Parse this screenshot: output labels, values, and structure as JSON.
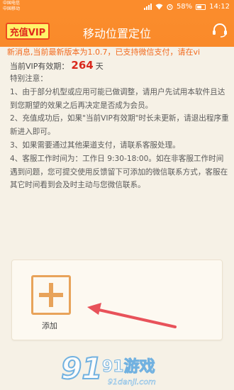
{
  "status_bar": {
    "carrier_line1": "中国电信",
    "carrier_line2": "中国移动",
    "battery": "58%",
    "time": "14:12"
  },
  "header": {
    "vip_button_label": "充值VIP",
    "title": "移动位置定位"
  },
  "notice": "新消息,当前最新版本为1.0.7，已支持微信支付，请在vi",
  "validity": {
    "label": "当前VIP有效期：",
    "days": "264",
    "unit": "天"
  },
  "notes": {
    "heading": "特别注意：",
    "items": [
      "1、由于部分机型或应用可能已做调整，请用户先试用本软件且达到您期望的效果之后再决定是否成为会员。",
      "2、充值成功后，如果\"当前VIP有效期\"时长未更新，请退出程序重新进入即可。",
      "3、如果需要通过其他渠道支付，请联系客服处理。",
      "4、客服工作时间为：工作日 9:30-18:00。如在非客服工作时间遇到问题，您可提交使用反馈留下可添加的微信联系方式，客服在其它时间看到会及时主动与您微信联系。"
    ]
  },
  "add_card": {
    "label": "添加"
  },
  "watermark": {
    "text": "91游戏",
    "url": "91danji.com"
  },
  "colors": {
    "accent": "#fb8c2c",
    "notice": "#f26b1f",
    "days": "#d9281c",
    "add_icon": "#e8a35a",
    "arrow": "#e8525a"
  }
}
